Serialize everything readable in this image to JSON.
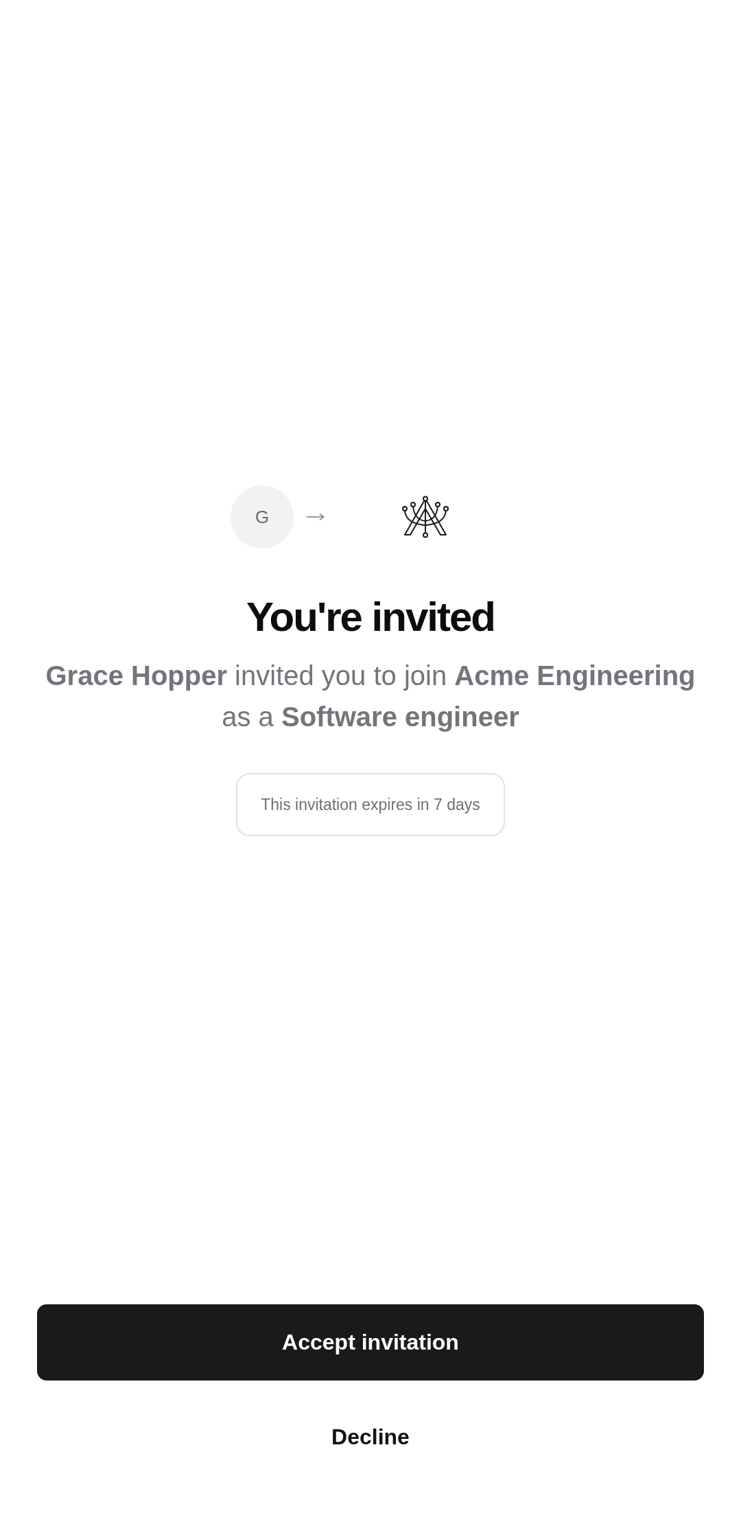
{
  "invite": {
    "avatar_initial": "G",
    "title": "You're invited",
    "message": "**Grace Hopper** invited you to join **Acme Engineering** as a **Software engineer**",
    "expiry_note": "This invitation expires in 7 days"
  },
  "actions": [
    {
      "kind": "primary",
      "label": "Accept invitation"
    },
    {
      "kind": "secondary",
      "label": "Decline"
    }
  ]
}
